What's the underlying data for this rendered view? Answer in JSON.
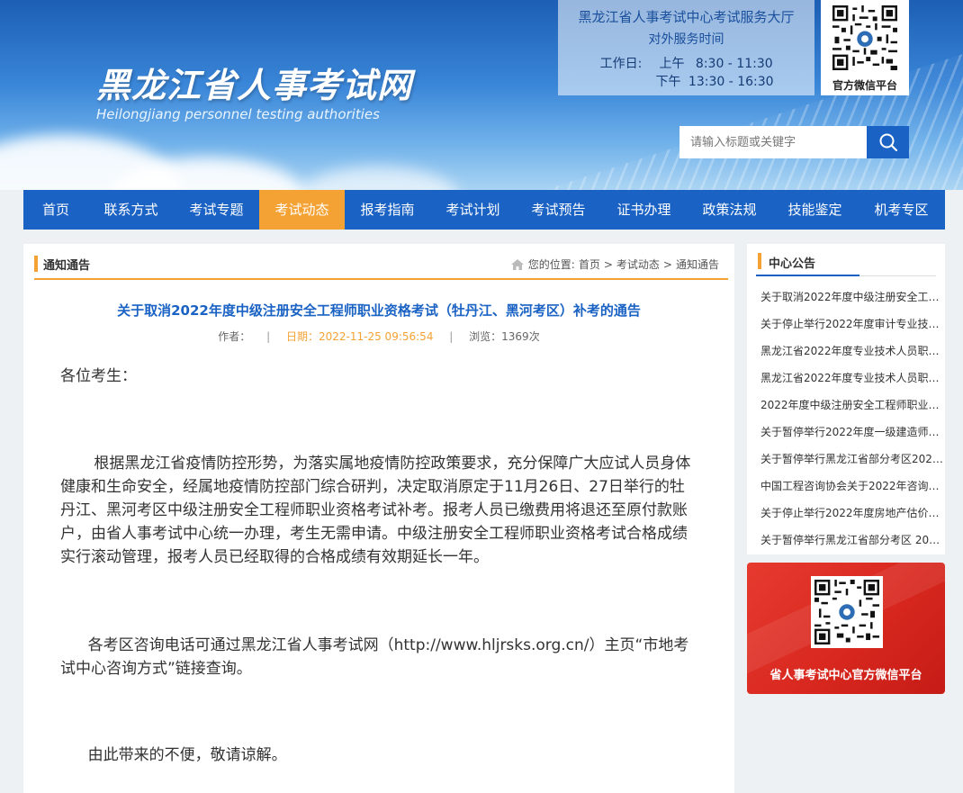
{
  "header": {
    "site_title": "黑龙江省人事考试网",
    "site_subtitle": "Heilongjiang personnel testing authorities",
    "service_title": "黑龙江省人事考试中心考试服务大厅",
    "service_subtitle": "对外服务时间",
    "workday_label": "工作日:",
    "am_label": "上午",
    "am_time": "8:30 - 11:30",
    "pm_label": "下午",
    "pm_time": "13:30 - 16:30",
    "qr_caption": "官方微信平台",
    "search_placeholder": "请输入标题或关键字"
  },
  "nav": {
    "items": [
      "首页",
      "联系方式",
      "考试专题",
      "考试动态",
      "报考指南",
      "考试计划",
      "考试预告",
      "证书办理",
      "政策法规",
      "技能鉴定",
      "机考专区"
    ],
    "active_index": 3
  },
  "main": {
    "section_title": "通知通告",
    "breadcrumb_label": "您的位置:",
    "breadcrumb": [
      "首页",
      "考试动态",
      "通知通告"
    ],
    "breadcrumb_sep": ">",
    "article_title": "关于取消2022年度中级注册安全工程师职业资格考试（牡丹江、黑河考区）补考的通告",
    "meta_author": "作者：",
    "meta_date": "日期：2022-11-25 09:56:54",
    "meta_views": "浏览：1369次",
    "meta_sep": "|",
    "paragraphs": [
      "各位考生：",
      "根据黑龙江省疫情防控形势，为落实属地疫情防控政策要求，充分保障广大应试人员身体健康和生命安全，经属地疫情防控部门综合研判，决定取消原定于11月26日、27日举行的牡丹江、黑河考区中级注册安全工程师职业资格考试补考。报考人员已缴费用将退还至原付款账户，由省人事考试中心统一办理，考生无需申请。中级注册安全工程师职业资格考试合格成绩实行滚动管理，报考人员已经取得的合格成绩有效期延长一年。",
      "各考区咨询电话可通过黑龙江省人事考试网（http://www.hljrsks.org.cn/）主页“市地考试中心咨询方式”链接查询。",
      "由此带来的不便，敬请谅解。"
    ]
  },
  "sidebar": {
    "title": "中心公告",
    "items": [
      "关于取消2022年度中级注册安全工…",
      "关于停止举行2022年度审计专业技…",
      "黑龙江省2022年度专业技术人员职…",
      "黑龙江省2022年度专业技术人员职…",
      "2022年度中级注册安全工程师职业…",
      "关于暂停举行2022年度一级建造师…",
      "关于暂停举行黑龙江省部分考区202…",
      "中国工程咨询协会关于2022年咨询…",
      "关于停止举行2022年度房地产估价…",
      "关于暂停举行黑龙江省部分考区 202…"
    ],
    "wechat_caption": "省人事考试中心官方微信平台"
  },
  "colors": {
    "nav_blue": "#1a62c4",
    "accent_orange": "#f5a234",
    "link_blue": "#1a62c4",
    "card_red": "#d8281f"
  }
}
